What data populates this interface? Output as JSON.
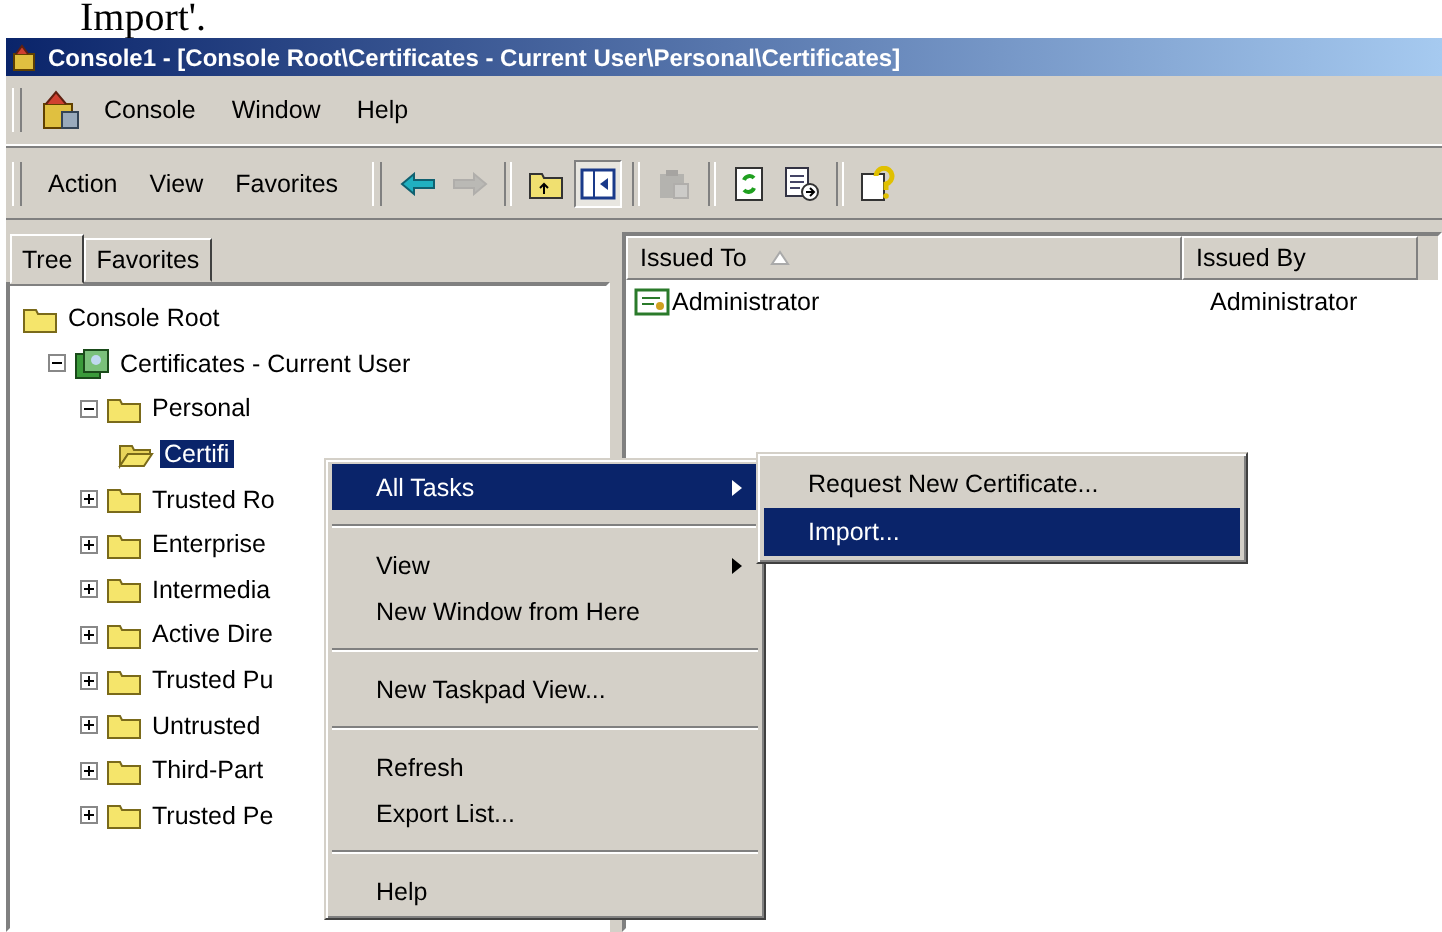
{
  "caption": "Import'.",
  "window": {
    "title": "Console1 - [Console Root\\Certificates - Current User\\Personal\\Certificates]"
  },
  "menu_bar": [
    "Console",
    "Window",
    "Help"
  ],
  "toolbar": {
    "menus": [
      "Action",
      "View",
      "Favorites"
    ],
    "buttons": [
      {
        "kind": "back",
        "disabled": false,
        "pressed": false
      },
      {
        "kind": "forward",
        "disabled": true,
        "pressed": false
      },
      {
        "kind": "separator"
      },
      {
        "kind": "up",
        "disabled": false,
        "pressed": false
      },
      {
        "kind": "tree-toggle",
        "disabled": false,
        "pressed": true
      },
      {
        "kind": "separator"
      },
      {
        "kind": "clipboard",
        "disabled": true,
        "pressed": false
      },
      {
        "kind": "separator"
      },
      {
        "kind": "refresh",
        "disabled": false,
        "pressed": false
      },
      {
        "kind": "export",
        "disabled": false,
        "pressed": false
      },
      {
        "kind": "separator"
      },
      {
        "kind": "help",
        "disabled": false,
        "pressed": false
      }
    ]
  },
  "tabs": [
    {
      "label": "Tree",
      "selected": true
    },
    {
      "label": "Favorites",
      "selected": false
    }
  ],
  "tree": [
    {
      "label": "Console Root",
      "kind": "folder",
      "selected": false,
      "children": [
        {
          "label": "Certificates - Current User",
          "kind": "store",
          "expanded": true,
          "selected": false,
          "children": [
            {
              "label": "Personal",
              "kind": "folder",
              "expanded": true,
              "selected": false,
              "children": [
                {
                  "label": "Certifi",
                  "kind": "open-folder",
                  "selected": true
                }
              ]
            },
            {
              "label": "Trusted Ro",
              "kind": "folder",
              "expanded": false,
              "selected": false
            },
            {
              "label": "Enterprise",
              "kind": "folder",
              "expanded": false,
              "selected": false
            },
            {
              "label": "Intermedia",
              "kind": "folder",
              "expanded": false,
              "selected": false
            },
            {
              "label": "Active Dire",
              "kind": "folder",
              "expanded": false,
              "selected": false
            },
            {
              "label": "Trusted Pu",
              "kind": "folder",
              "expanded": false,
              "selected": false
            },
            {
              "label": "Untrusted",
              "kind": "folder",
              "expanded": false,
              "selected": false
            },
            {
              "label": "Third-Part",
              "kind": "folder",
              "expanded": false,
              "selected": false
            },
            {
              "label": "Trusted Pe",
              "kind": "folder",
              "expanded": false,
              "selected": false
            }
          ]
        }
      ]
    }
  ],
  "list": {
    "columns": [
      {
        "label": "Issued To",
        "sorted": true
      },
      {
        "label": "Issued By",
        "sorted": false
      }
    ],
    "rows": [
      {
        "cells": [
          "Administrator",
          "Administrator"
        ]
      }
    ]
  },
  "context_menu": [
    {
      "kind": "item",
      "label": "All Tasks",
      "submenu": true,
      "selected": true
    },
    {
      "kind": "separator"
    },
    {
      "kind": "item",
      "label": "View",
      "submenu": true,
      "selected": false
    },
    {
      "kind": "item",
      "label": "New Window from Here",
      "submenu": false,
      "selected": false
    },
    {
      "kind": "separator"
    },
    {
      "kind": "item",
      "label": "New Taskpad View...",
      "submenu": false,
      "selected": false
    },
    {
      "kind": "separator"
    },
    {
      "kind": "item",
      "label": "Refresh",
      "submenu": false,
      "selected": false
    },
    {
      "kind": "item",
      "label": "Export List...",
      "submenu": false,
      "selected": false
    },
    {
      "kind": "separator"
    },
    {
      "kind": "item",
      "label": "Help",
      "submenu": false,
      "selected": false
    }
  ],
  "submenu": [
    {
      "label": "Request New Certificate...",
      "selected": false
    },
    {
      "label": "Import...",
      "selected": true
    }
  ]
}
